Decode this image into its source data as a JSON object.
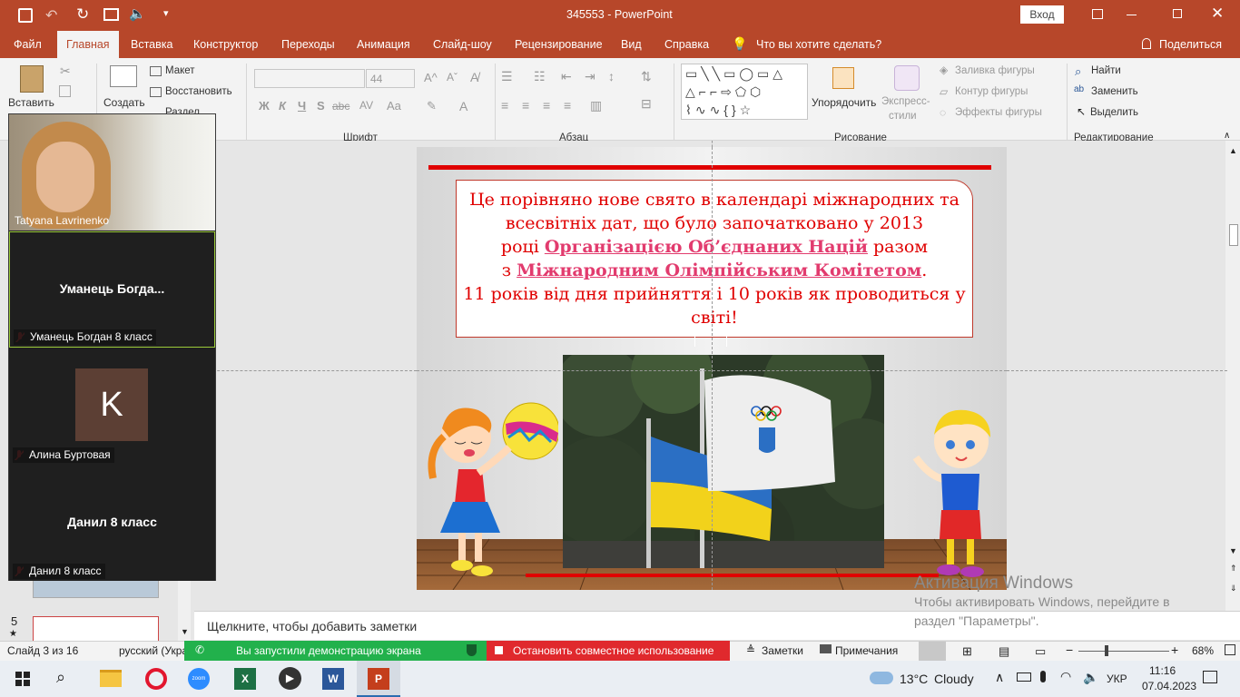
{
  "window": {
    "doc_name": "345553",
    "app_name": "PowerPoint",
    "signin": "Вход"
  },
  "tabs": [
    "Файл",
    "Главная",
    "Вставка",
    "Конструктор",
    "Переходы",
    "Анимация",
    "Слайд-шоу",
    "Рецензирование",
    "Вид",
    "Справка"
  ],
  "tell_me": "Что вы хотите сделать?",
  "share": "Поделиться",
  "ribbon": {
    "paste": "Вставить",
    "create": "Создать",
    "layout": "Макет",
    "reset": "Восстановить",
    "section": "Раздел",
    "font_size": "44",
    "font_group": "Шрифт",
    "paragraph_group": "Абзац",
    "drawing_group": "Рисование",
    "editing_group": "Редактирование",
    "arrange": "Упорядочить",
    "quick_styles_1": "Экспресс-",
    "quick_styles_2": "стили",
    "fill": "Заливка фигуры",
    "outline": "Контур фигуры",
    "effects": "Эффекты фигуры",
    "find": "Найти",
    "replace": "Заменить",
    "select": "Выделить",
    "bold": "Ж",
    "italic": "К",
    "underline": "Ч",
    "strike": "S",
    "abc": "abc",
    "aa": "Aa",
    "font_color": "A"
  },
  "zoom": {
    "participants": [
      {
        "name": "Tatyana Lavrinenko",
        "center": "",
        "initial": ""
      },
      {
        "name": "Уманець Богдан 8 класс",
        "center": "Уманець  Богда...",
        "initial": ""
      },
      {
        "name": "Алина Буртовая",
        "center": "",
        "initial": "K"
      },
      {
        "name": "Данил 8 класс",
        "center": "Данил 8 класс",
        "initial": ""
      }
    ]
  },
  "thumbnails": {
    "slide_number": "5"
  },
  "slide": {
    "line1": "Це порівняно нове свято в календарі міжнародних та",
    "line2": "всесвітніх дат, що було започатковано у 2013",
    "line3a": "році ",
    "line3b": "Організацією Об’єднаних Націй",
    "line3c": " разом",
    "line4a": "з ",
    "line4b": "Міжнародним Олімпійським Комітетом",
    "line4c": ".",
    "line5": "11 років від дня прийняття і 10 років як проводиться у",
    "line6": "світі!",
    "accent_color": "#e00000"
  },
  "notes_placeholder": "Щелкните, чтобы добавить заметки",
  "watermark": {
    "title": "Активация Windows",
    "line1": "Чтобы активировать Windows, перейдите в",
    "line2": "раздел \"Параметры\"."
  },
  "status": {
    "slide": "Слайд 3 из 16",
    "language": "русский (Укра",
    "share_banner": "Вы запустили демонстрацию экрана",
    "stop_share": "Остановить совместное использование",
    "notes": "Заметки",
    "comments": "Примечания",
    "zoom": "68%"
  },
  "taskbar": {
    "weather_temp": "13°C",
    "weather": "Cloudy",
    "lang": "УКР",
    "time": "11:16",
    "date": "07.04.2023"
  }
}
